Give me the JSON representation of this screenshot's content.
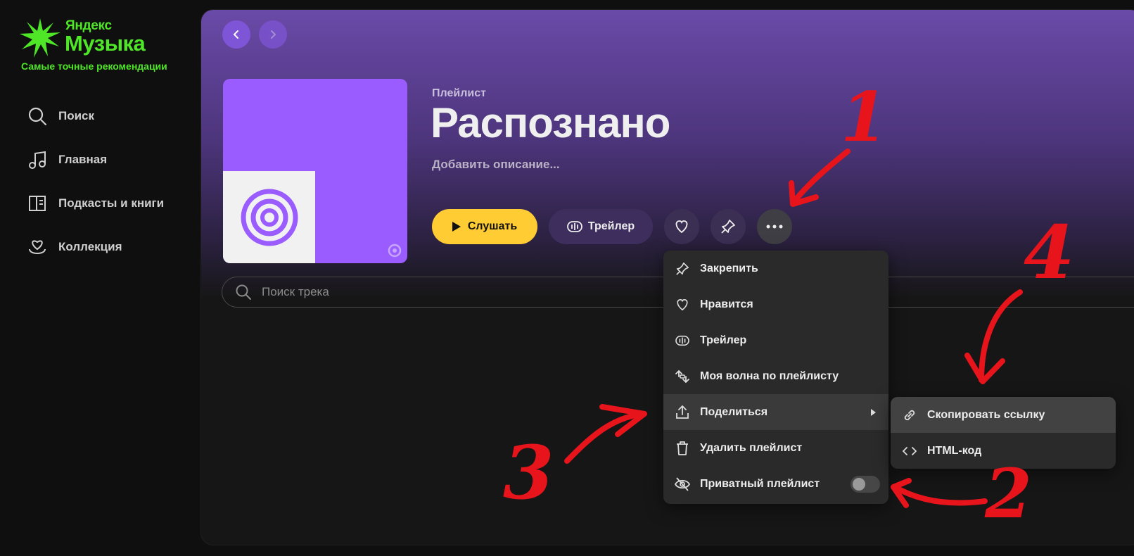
{
  "brand": {
    "small": "Яндекс",
    "big": "Музыка",
    "tagline": "Самые точные рекомендации",
    "color": "#4ee627"
  },
  "sidebar": {
    "items": [
      {
        "label": "Поиск",
        "icon": "search-icon"
      },
      {
        "label": "Главная",
        "icon": "music-note-icon"
      },
      {
        "label": "Подкасты и книги",
        "icon": "book-icon"
      },
      {
        "label": "Коллекция",
        "icon": "heart-hand-icon"
      }
    ]
  },
  "playlist": {
    "type": "Плейлист",
    "title": "Распознано",
    "description": "Добавить описание...",
    "accent": "#9a5cff"
  },
  "actions": {
    "play_label": "Слушать",
    "trailer_label": "Трейлер",
    "play_color": "#ffcc33"
  },
  "search": {
    "placeholder": "Поиск трека"
  },
  "menu": {
    "items": [
      {
        "label": "Закрепить",
        "icon": "pin-icon"
      },
      {
        "label": "Нравится",
        "icon": "heart-icon"
      },
      {
        "label": "Трейлер",
        "icon": "waveform-icon"
      },
      {
        "label": "Моя волна по плейлисту",
        "icon": "wave-icon"
      },
      {
        "label": "Поделиться",
        "icon": "share-icon"
      },
      {
        "label": "Удалить плейлист",
        "icon": "trash-icon"
      },
      {
        "label": "Приватный плейлист",
        "icon": "eye-off-icon",
        "toggle": false
      }
    ]
  },
  "submenu": {
    "items": [
      {
        "label": "Скопировать ссылку",
        "icon": "link-icon"
      },
      {
        "label": "HTML-код",
        "icon": "code-icon"
      }
    ]
  },
  "annotations": {
    "labels": [
      "1",
      "2",
      "3",
      "4"
    ],
    "color": "#e8141c"
  }
}
